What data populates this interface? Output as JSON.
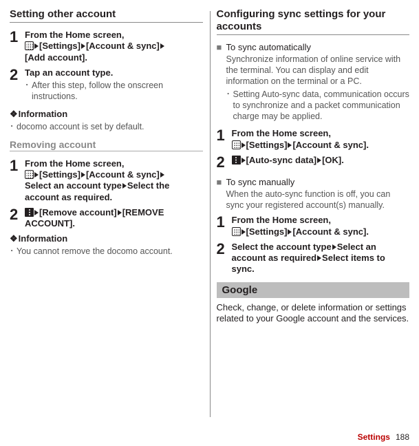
{
  "left": {
    "title": "Setting other account",
    "step1": {
      "num": "1",
      "line1": "From the Home screen,",
      "seg_settings": "[Settings]",
      "seg_acct": "[Account & sync]",
      "seg_add": "[Add account]."
    },
    "step2": {
      "num": "2",
      "main": "Tap an account type.",
      "note": "After this step, follow the onscreen instructions."
    },
    "info_a": {
      "heading": "Information",
      "note": "docomo account is set by default."
    },
    "removing": {
      "title": "Removing account",
      "step1": {
        "num": "1",
        "line1": "From the Home screen,",
        "seg_settings": "[Settings]",
        "seg_acct": "[Account & sync]",
        "line2": "Select an account type",
        "line3": "Select the account as required."
      },
      "step2": {
        "num": "2",
        "seg_remove": "[Remove account]",
        "seg_remove2": "[REMOVE ACCOUNT]."
      }
    },
    "info_b": {
      "heading": "Information",
      "note": "You cannot remove the docomo account."
    }
  },
  "right": {
    "title": "Configuring sync settings for your accounts",
    "auto": {
      "title": "To sync automatically",
      "desc": "Synchronize information of online service with the terminal. You can display and edit information on the terminal or a PC.",
      "note": "Setting Auto-sync data, communication occurs to synchronize and a packet communication charge may be applied."
    },
    "step1": {
      "num": "1",
      "line1": "From the Home screen,",
      "seg_settings": "[Settings]",
      "seg_acct": "[Account & sync]."
    },
    "step2": {
      "num": "2",
      "seg_auto": "[Auto-sync data]",
      "seg_ok": "[OK]."
    },
    "manual": {
      "title": "To sync manually",
      "desc": "When the auto-sync function is off, you can sync your registered account(s) manually."
    },
    "m_step1": {
      "num": "1",
      "line1": "From the Home screen,",
      "seg_settings": "[Settings]",
      "seg_acct": "[Account & sync]."
    },
    "m_step2": {
      "num": "2",
      "line1": "Select the account type",
      "line2": "Select an account as required",
      "line3": "Select items to sync."
    },
    "google": {
      "title": "Google",
      "desc": "Check, change, or delete information or settings related to your Google account and the services."
    }
  },
  "footer": {
    "category": "Settings",
    "page": "188"
  }
}
